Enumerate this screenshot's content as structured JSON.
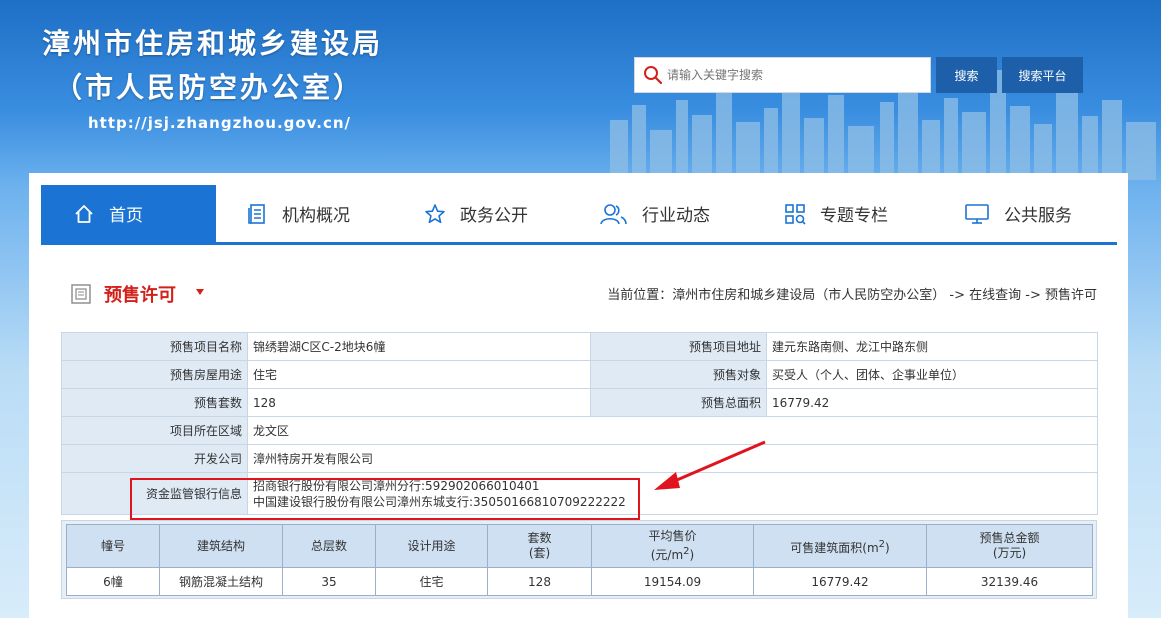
{
  "site": {
    "title_line1": "漳州市住房和城乡建设局",
    "title_line2": "（市人民防空办公室）",
    "url": "http://jsj.zhangzhou.gov.cn/"
  },
  "search": {
    "placeholder": "请输入关键字搜索",
    "search_button": "搜索",
    "platform_button": "搜索平台"
  },
  "nav": {
    "items": [
      {
        "label": "首页",
        "icon": "home-icon",
        "active": true
      },
      {
        "label": "机构概况",
        "icon": "document-list-icon"
      },
      {
        "label": "政务公开",
        "icon": "star-icon"
      },
      {
        "label": "行业动态",
        "icon": "users-icon"
      },
      {
        "label": "专题专栏",
        "icon": "grid-search-icon"
      },
      {
        "label": "公共服务",
        "icon": "monitor-icon"
      }
    ]
  },
  "category": {
    "title": "预售许可",
    "breadcrumb": "当前位置：漳州市住房和城乡建设局（市人民防空办公室） -> 在线查询 -> 预售许可"
  },
  "info": {
    "project_name_label": "预售项目名称",
    "project_name": "锦绣碧湖C区C-2地块6幢",
    "project_address_label": "预售项目地址",
    "project_address": "建元东路南侧、龙江中路东侧",
    "usage_label": "预售房屋用途",
    "usage": "住宅",
    "target_label": "预售对象",
    "target": "买受人（个人、团体、企事业单位）",
    "units_label": "预售套数",
    "units": "128",
    "area_label": "预售总面积",
    "area": "16779.42",
    "district_label": "项目所在区域",
    "district": "龙文区",
    "developer_label": "开发公司",
    "developer": "漳州特房开发有限公司",
    "bank_label": "资金监管银行信息",
    "bank_line1": "招商银行股份有限公司漳州分行:592902066010401",
    "bank_line2": "中国建设银行股份有限公司漳州东城支行:35050166810709222222"
  },
  "units_table": {
    "headers": {
      "building": "幢号",
      "structure": "建筑结构",
      "floors": "总层数",
      "design_use": "设计用途",
      "sets_1": "套数",
      "sets_2": "(套)",
      "price_1": "平均售价",
      "price_2a": "(元/m",
      "price_2b": "2",
      "price_2c": ")",
      "saleable_area_1": "可售建筑面积(m",
      "saleable_area_2": "2",
      "saleable_area_3": ")",
      "total_1": "预售总金额",
      "total_2": "(万元)"
    },
    "rows": [
      {
        "building": "6幢",
        "structure": "钢筋混凝土结构",
        "floors": "35",
        "design_use": "住宅",
        "sets": "128",
        "price": "19154.09",
        "saleable_area": "16779.42",
        "total": "32139.46"
      }
    ]
  },
  "colors": {
    "nav_active": "#1b74d3",
    "category_red": "#d2201a",
    "label_bg": "#dfeaf5",
    "button_blue": "#1d5fa8",
    "highlight_red": "#e0141e"
  }
}
